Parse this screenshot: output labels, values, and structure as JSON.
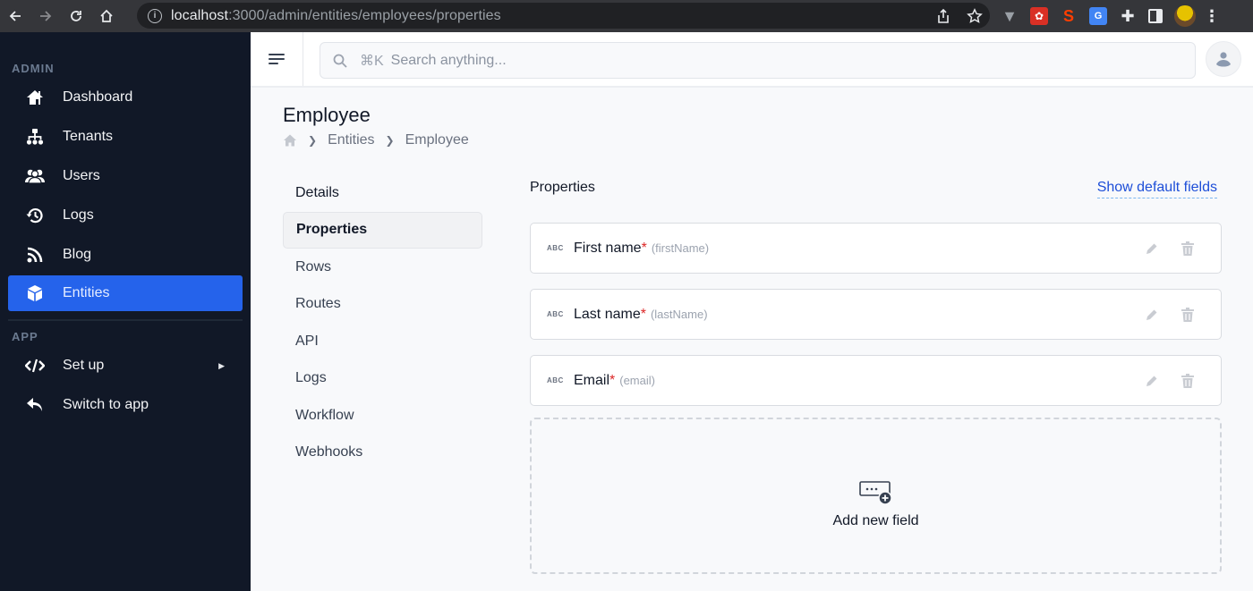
{
  "browser": {
    "url_host": "localhost",
    "url_path": ":3000/admin/entities/employees/properties",
    "extensions": [
      "vue-devtools-icon",
      "extension-red-icon",
      "svelte-icon",
      "google-translate-icon",
      "puzzle-icon",
      "side-panel-icon",
      "profile-avatar",
      "kebab-menu-icon"
    ]
  },
  "sidebar": {
    "sections": [
      {
        "label": "ADMIN",
        "items": [
          {
            "label": "Dashboard",
            "icon": "home-icon"
          },
          {
            "label": "Tenants",
            "icon": "hierarchy-icon"
          },
          {
            "label": "Users",
            "icon": "users-icon"
          },
          {
            "label": "Logs",
            "icon": "history-icon"
          },
          {
            "label": "Blog",
            "icon": "rss-icon"
          },
          {
            "label": "Entities",
            "icon": "cube-icon",
            "active": true
          }
        ]
      },
      {
        "label": "APP",
        "items": [
          {
            "label": "Set up",
            "icon": "code-icon",
            "has_submenu": true
          },
          {
            "label": "Switch to app",
            "icon": "reply-arrow-icon"
          }
        ]
      }
    ]
  },
  "topbar": {
    "search_shortcut": "⌘K",
    "search_placeholder": "Search anything...",
    "search_value": ""
  },
  "page": {
    "title": "Employee",
    "breadcrumb": [
      "Entities",
      "Employee"
    ]
  },
  "subnav": {
    "items": [
      "Details",
      "Properties",
      "Rows",
      "Routes",
      "API",
      "Logs",
      "Workflow",
      "Webhooks"
    ],
    "active": "Properties"
  },
  "properties": {
    "title": "Properties",
    "show_default_label": "Show default fields",
    "fields": [
      {
        "type": "ABC",
        "name": "First name",
        "required": "*",
        "key": "(firstName)"
      },
      {
        "type": "ABC",
        "name": "Last name",
        "required": "*",
        "key": "(lastName)"
      },
      {
        "type": "ABC",
        "name": "Email",
        "required": "*",
        "key": "(email)"
      }
    ],
    "add_label": "Add new field"
  },
  "colors": {
    "sidebar_bg": "#111827",
    "accent": "#2563eb",
    "link": "#1d4ed8",
    "required": "#dc2626"
  }
}
